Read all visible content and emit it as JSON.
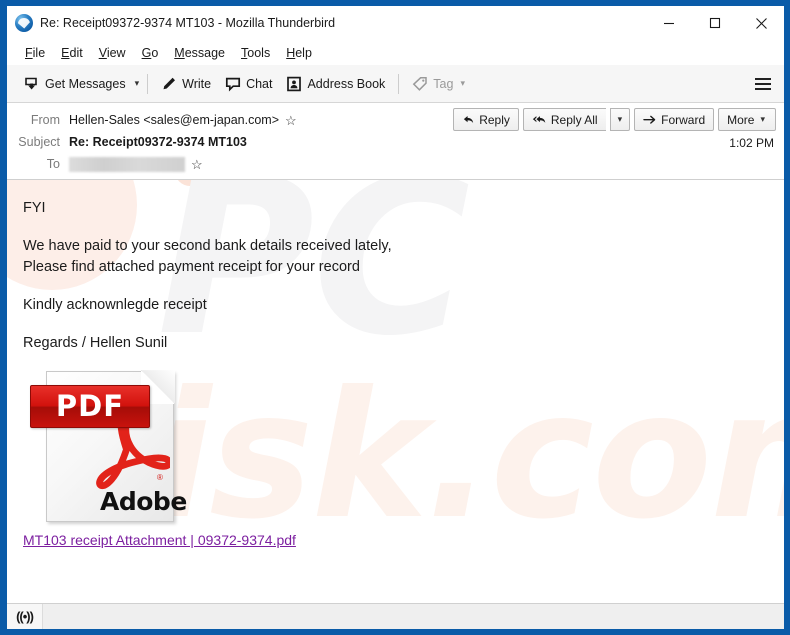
{
  "window": {
    "title": "Re: Receipt09372-9374 MT103 - Mozilla Thunderbird",
    "app_icon": "thunderbird-icon",
    "border_color": "#0a5ba8",
    "controls": {
      "minimize": "minimize-icon",
      "maximize": "maximize-icon",
      "close": "close-icon"
    }
  },
  "menubar": {
    "items": [
      {
        "label": "File",
        "accesskey": "F"
      },
      {
        "label": "Edit",
        "accesskey": "E"
      },
      {
        "label": "View",
        "accesskey": "V"
      },
      {
        "label": "Go",
        "accesskey": "G"
      },
      {
        "label": "Message",
        "accesskey": "M"
      },
      {
        "label": "Tools",
        "accesskey": "T"
      },
      {
        "label": "Help",
        "accesskey": "H"
      }
    ]
  },
  "toolbar": {
    "get_messages": "Get Messages",
    "write": "Write",
    "chat": "Chat",
    "address_book": "Address Book",
    "tag": "Tag",
    "tag_disabled": true,
    "menu_icon": "hamburger-menu-icon"
  },
  "header": {
    "from_label": "From",
    "from_value": "Hellen-Sales <sales@em-japan.com>",
    "subject_label": "Subject",
    "subject_value": "Re: Receipt09372-9374 MT103",
    "to_label": "To",
    "to_value": "",
    "to_redacted": true,
    "timestamp": "1:02 PM",
    "star_icon": "star-icon",
    "actions": {
      "reply": "Reply",
      "reply_all": "Reply All",
      "forward": "Forward",
      "more": "More"
    }
  },
  "body": {
    "paragraphs": [
      "FYI",
      "We have paid to your second bank details received lately,\nPlease find attached payment receipt for your record",
      "Kindly acknownlegde receipt",
      "Regards / Hellen Sunil"
    ],
    "line1": "FYI",
    "line2a": "We have paid to your second bank details received lately,",
    "line2b": "Please find attached payment receipt for your record",
    "line3": "Kindly acknownlegde receipt",
    "line4": "Regards / Hellen Sunil"
  },
  "attachment": {
    "icon": "pdf-file-icon",
    "badge_text": "PDF",
    "brand_text": "Adobe",
    "registered_mark": "®",
    "link_text": "MT103 receipt Attachment | 09372-9374.pdf",
    "link_color": "#7c1fa0"
  },
  "watermark": {
    "top_text": "PC",
    "bottom_text": "risk.com"
  },
  "statusbar": {
    "icon": "online-status-icon",
    "icon_glyph": "((•))",
    "text": ""
  }
}
